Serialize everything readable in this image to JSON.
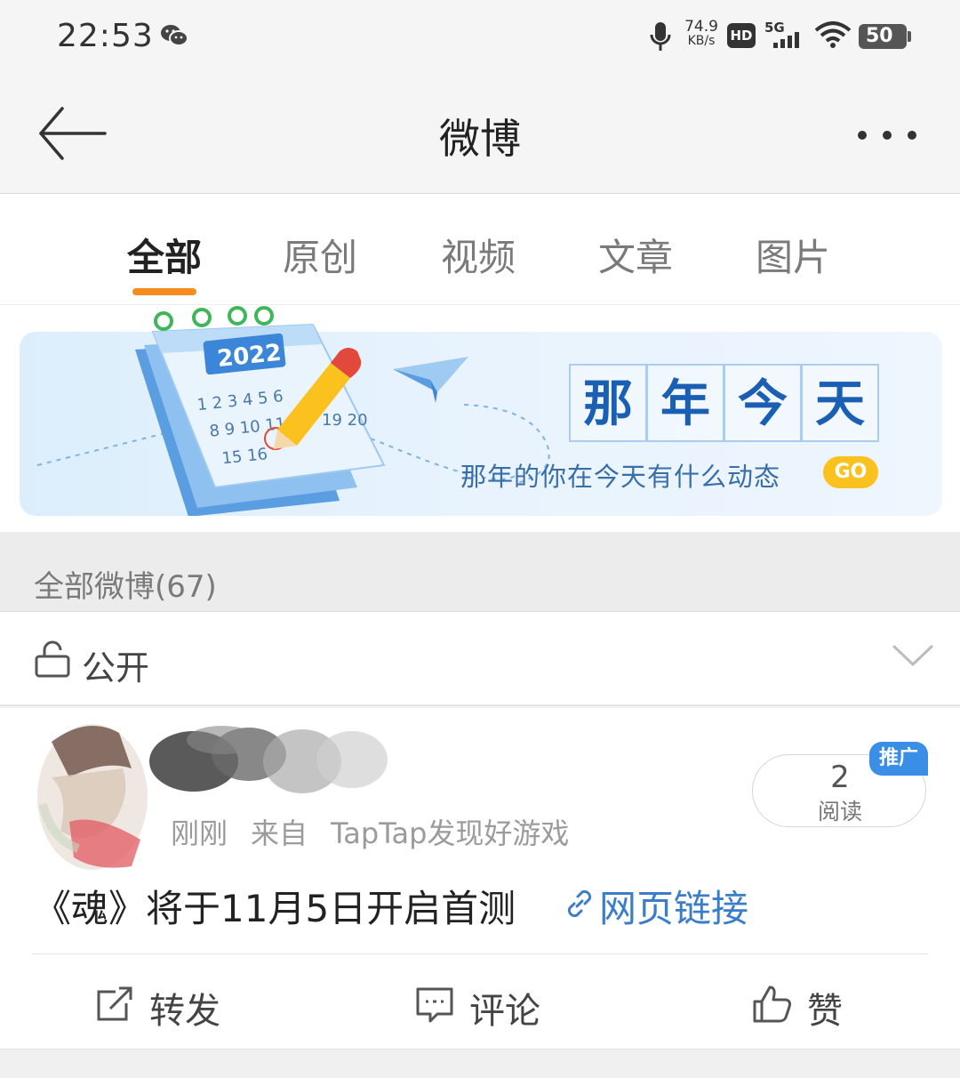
{
  "status_bar": {
    "time": "22:53",
    "net_speed_value": "74.9",
    "net_speed_unit": "KB/s",
    "hd_label": "HD",
    "network_label": "5G",
    "battery": "50"
  },
  "header": {
    "title": "微博"
  },
  "tabs": [
    {
      "label": "全部",
      "active": true
    },
    {
      "label": "原创",
      "active": false
    },
    {
      "label": "视频",
      "active": false
    },
    {
      "label": "文章",
      "active": false
    },
    {
      "label": "图片",
      "active": false
    }
  ],
  "banner": {
    "title_chars": [
      "那",
      "年",
      "今",
      "天"
    ],
    "subtitle": "那年的你在今天有什么动态",
    "go_label": "GO",
    "calendar_year": "2022"
  },
  "section": {
    "title": "全部微博(67)"
  },
  "visibility": {
    "label": "公开"
  },
  "post": {
    "time": "刚刚",
    "source_prefix": "来自",
    "source": "TapTap发现好游戏",
    "read_count": "2",
    "read_label": "阅读",
    "promote_label": "推广",
    "text": "《魂》将于11月5日开启首测",
    "link_label": "网页链接",
    "actions": {
      "repost": "转发",
      "comment": "评论",
      "like": "赞"
    }
  },
  "colors": {
    "accent": "#f78c1e",
    "link": "#3a7dc9",
    "badge": "#3a8ee6",
    "go_button": "#fbc21f"
  }
}
